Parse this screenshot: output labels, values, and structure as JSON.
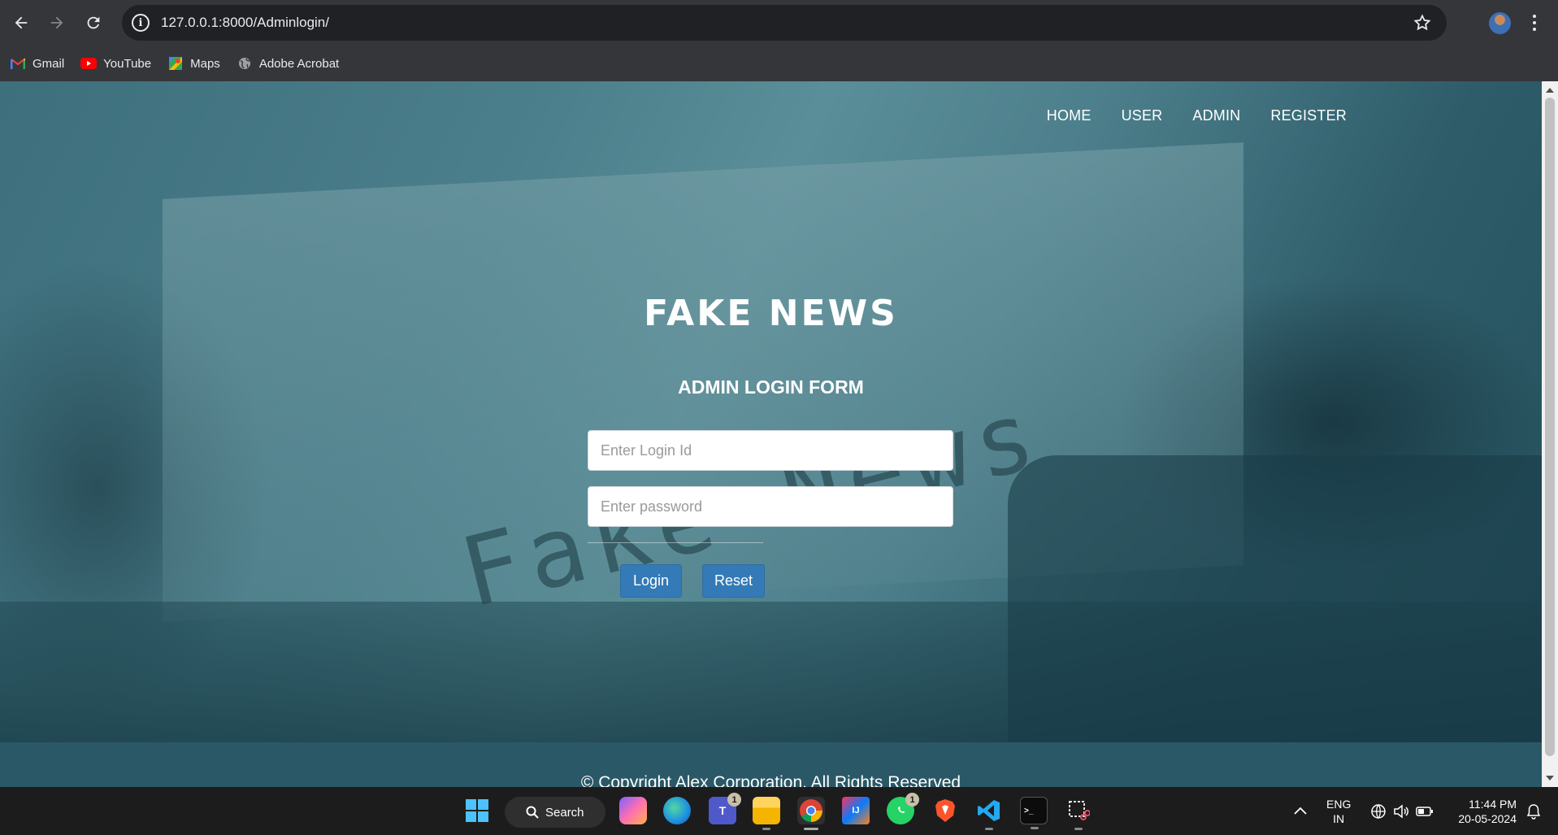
{
  "browser": {
    "url": "127.0.0.1:8000/Adminlogin/",
    "bookmarks": [
      {
        "label": "Gmail",
        "icon": "gmail-icon"
      },
      {
        "label": "YouTube",
        "icon": "youtube-icon"
      },
      {
        "label": "Maps",
        "icon": "maps-icon"
      },
      {
        "label": "Adobe Acrobat",
        "icon": "globe-icon"
      }
    ]
  },
  "site": {
    "nav": [
      "HOME",
      "USER",
      "ADMIN",
      "REGISTER"
    ],
    "brand": "FAKE NEWS",
    "watermark": "Fake News",
    "form_title": "ADMIN LOGIN FORM",
    "login_placeholder": "Enter Login Id",
    "password_placeholder": "Enter password",
    "login_button": "Login",
    "reset_button": "Reset",
    "footer": "© Copyright Alex Corporation. All Rights Reserved"
  },
  "taskbar": {
    "search_label": "Search",
    "teams_badge": "1",
    "whatsapp_badge": "1",
    "language": "ENG",
    "region": "IN",
    "time": "11:44 PM",
    "date": "20-05-2024"
  },
  "colors": {
    "page_teal": "#2a5866",
    "button_blue": "#337ab7",
    "chrome_dark": "#35363a"
  }
}
